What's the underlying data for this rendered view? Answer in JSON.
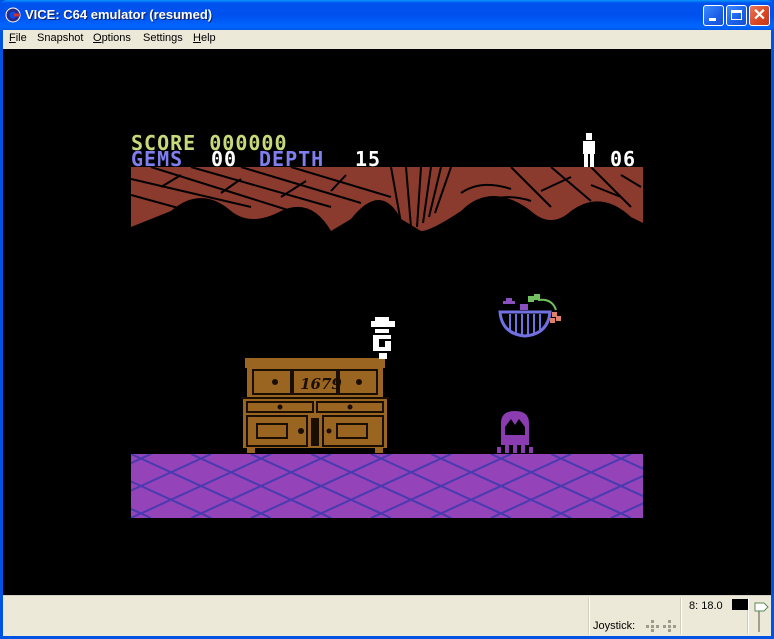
{
  "window": {
    "title": "VICE: C64 emulator (resumed)",
    "controls": {
      "minimize": "minimize-button",
      "maximize": "maximize-button",
      "close": "close-button"
    }
  },
  "menu": [
    {
      "label": "File",
      "accel": "F",
      "rest": "ile"
    },
    {
      "label": "Snapshot",
      "accel": "",
      "rest": "Snapshot"
    },
    {
      "label": "Options",
      "accel": "O",
      "rest": "ptions"
    },
    {
      "label": "Settings",
      "accel": "",
      "rest": "Settings"
    },
    {
      "label": "Help",
      "accel": "H",
      "rest": "elp"
    }
  ],
  "game": {
    "score_label": "SCORE",
    "score_value": "000000",
    "gems_label": "GEMS",
    "gems_value": "00",
    "depth_label": "DEPTH",
    "depth_value": "15",
    "lives_value": "06",
    "dresser_year": "1679",
    "colors": {
      "score": "#c8d97a",
      "label_blue": "#7f7ff0",
      "ceiling": "#8b3a2e",
      "floor": "#9444b8",
      "floor_lines": "#4a3ab0",
      "dresser": "#9a6421",
      "creature": "#8a3cb0",
      "basket": "#7070e0"
    },
    "objects": [
      "player-miner",
      "dresser",
      "fruit-basket",
      "purple-creature",
      "lives-man-icon"
    ]
  },
  "status": {
    "joystick_label": "Joystick:",
    "speed": "8: 18.0"
  }
}
